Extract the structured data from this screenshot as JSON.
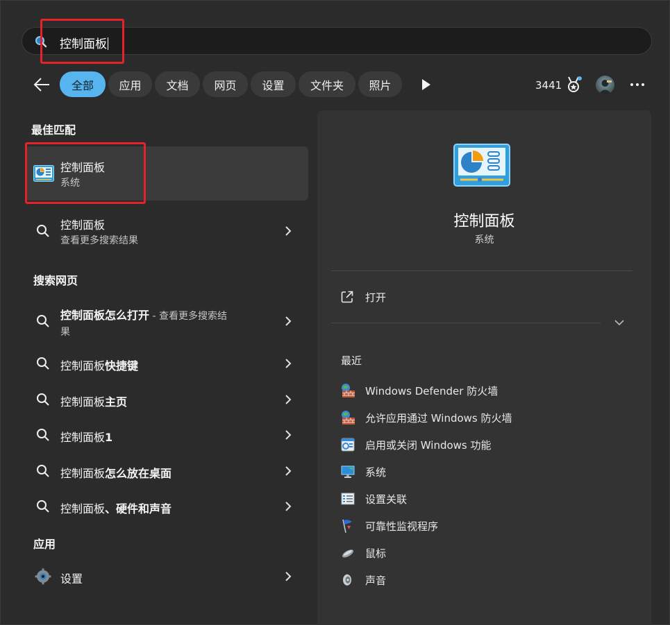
{
  "search": {
    "query": "控制面板"
  },
  "filters": {
    "items": [
      "全部",
      "应用",
      "文档",
      "网页",
      "设置",
      "文件夹",
      "照片"
    ],
    "active": "全部"
  },
  "header": {
    "points": "3441"
  },
  "best_match": {
    "section_title": "最佳匹配",
    "title": "控制面板",
    "subtitle": "系统"
  },
  "more_results": {
    "title": "控制面板",
    "subtitle": "查看更多搜索结果"
  },
  "web": {
    "section_title": "搜索网页",
    "items": [
      {
        "bold": "控制面板怎么打开",
        "suffix": " - 查看更多搜索结",
        "line2": "果"
      },
      {
        "normal": "控制面板",
        "bold": "快捷键"
      },
      {
        "normal": "控制面板",
        "bold": "主页"
      },
      {
        "normal": "控制面板",
        "bold": "1"
      },
      {
        "normal": "控制面板",
        "bold": "怎么放在桌面"
      },
      {
        "normal": "控制面板",
        "bold": "、硬件和声音"
      }
    ]
  },
  "apps": {
    "section_title": "应用",
    "items": [
      {
        "label": "设置"
      }
    ]
  },
  "detail": {
    "title": "控制面板",
    "subtitle": "系统",
    "open_label": "打开",
    "recent_title": "最近",
    "recent": [
      {
        "label": "Windows Defender 防火墙",
        "icon": "firewall-icon"
      },
      {
        "label": "允许应用通过 Windows 防火墙",
        "icon": "firewall-icon"
      },
      {
        "label": "启用或关闭 Windows 功能",
        "icon": "windows-features-icon"
      },
      {
        "label": "系统",
        "icon": "monitor-icon"
      },
      {
        "label": "设置关联",
        "icon": "list-icon"
      },
      {
        "label": "可靠性监视程序",
        "icon": "flag-icon"
      },
      {
        "label": "鼠标",
        "icon": "mouse-icon"
      },
      {
        "label": "声音",
        "icon": "speaker-icon"
      }
    ]
  },
  "colors": {
    "accent": "#56b4ee",
    "highlight_box": "#e3222b"
  }
}
